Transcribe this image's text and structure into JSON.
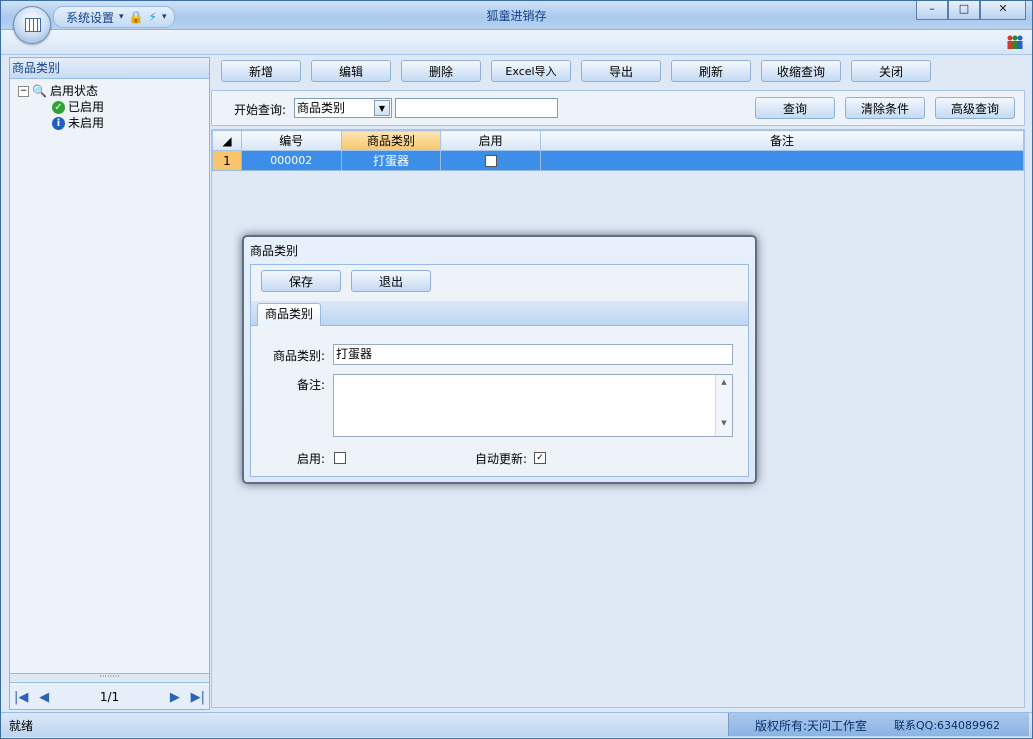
{
  "window": {
    "title": "狐童进销存",
    "qat_label": "系统设置",
    "min_label": "–",
    "max_label": "□",
    "close_label": "✕"
  },
  "sidebar": {
    "header": "商品类别",
    "tree_root": "启用状态",
    "items": [
      {
        "label": "已启用",
        "icon": "check-icon",
        "color": "#2fa52f"
      },
      {
        "label": "未启用",
        "icon": "info-icon",
        "color": "#1e5fc4"
      }
    ],
    "pager": {
      "page": "1/1",
      "first": "|◀",
      "prev": "◀",
      "next": "▶",
      "last": "▶|"
    }
  },
  "toolbar": {
    "buttons": [
      "新增",
      "编辑",
      "删除",
      "Excel导入",
      "导出",
      "刷新",
      "收缩查询",
      "关闭"
    ]
  },
  "search": {
    "label": "开始查询:",
    "field": "商品类别",
    "value": "",
    "query": "查询",
    "clear": "清除条件",
    "advanced": "高级查询"
  },
  "grid": {
    "columns": [
      "编号",
      "商品类别",
      "启用",
      "备注"
    ],
    "rows": [
      {
        "rownum": "1",
        "code": "000002",
        "category": "打蛋器",
        "enabled": false,
        "note": ""
      }
    ]
  },
  "dialog": {
    "title": "商品类别",
    "save": "保存",
    "exit": "退出",
    "tab": "商品类别",
    "category_label": "商品类别:",
    "category_value": "打蛋器",
    "note_label": "备注:",
    "note_value": "",
    "enabled_label": "启用:",
    "enabled": false,
    "auto_update_label": "自动更新:",
    "auto_update": true
  },
  "status": {
    "left": "就绪",
    "copyright": "版权所有:天问工作室",
    "contact": "联系QQ:634089962"
  }
}
